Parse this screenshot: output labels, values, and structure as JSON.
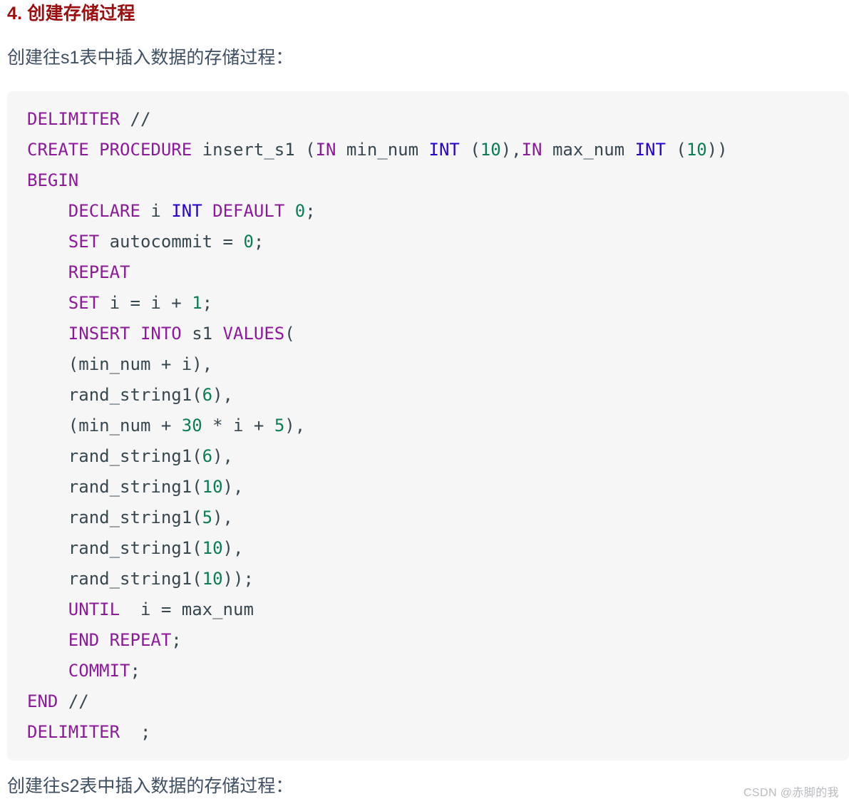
{
  "heading": "4. 创建存储过程",
  "intro_paragraph": "创建往s1表中插入数据的存储过程：",
  "closing_paragraph": "创建往s2表中插入数据的存储过程：",
  "watermark": "CSDN @赤脚的我",
  "colors": {
    "heading": "#9c0f10",
    "body_text": "#3f5063",
    "code_background": "#f6f6f7",
    "keyword": "#8d1a9b",
    "type": "#2a00d0",
    "number": "#0a7d55",
    "identifier": "#37474f",
    "watermark": "#b9bcc0"
  },
  "code": {
    "language": "sql",
    "lines": [
      [
        {
          "t": "DELIMITER",
          "c": "kw"
        },
        {
          "t": " ",
          "c": "id"
        },
        {
          "t": "//",
          "c": "id"
        }
      ],
      [
        {
          "t": "CREATE PROCEDURE",
          "c": "kw"
        },
        {
          "t": " insert_s1 (",
          "c": "id"
        },
        {
          "t": "IN",
          "c": "kw"
        },
        {
          "t": " min_num ",
          "c": "id"
        },
        {
          "t": "INT",
          "c": "typ"
        },
        {
          "t": " (",
          "c": "id"
        },
        {
          "t": "10",
          "c": "num"
        },
        {
          "t": "),",
          "c": "id"
        },
        {
          "t": "IN",
          "c": "kw"
        },
        {
          "t": " max_num ",
          "c": "id"
        },
        {
          "t": "INT",
          "c": "typ"
        },
        {
          "t": " (",
          "c": "id"
        },
        {
          "t": "10",
          "c": "num"
        },
        {
          "t": "))",
          "c": "id"
        }
      ],
      [
        {
          "t": "BEGIN",
          "c": "kw"
        }
      ],
      [
        {
          "t": "    ",
          "c": "id"
        },
        {
          "t": "DECLARE",
          "c": "kw"
        },
        {
          "t": " i ",
          "c": "id"
        },
        {
          "t": "INT",
          "c": "typ"
        },
        {
          "t": " ",
          "c": "id"
        },
        {
          "t": "DEFAULT",
          "c": "kw"
        },
        {
          "t": " ",
          "c": "id"
        },
        {
          "t": "0",
          "c": "num"
        },
        {
          "t": ";",
          "c": "id"
        }
      ],
      [
        {
          "t": "    ",
          "c": "id"
        },
        {
          "t": "SET",
          "c": "kw"
        },
        {
          "t": " autocommit = ",
          "c": "id"
        },
        {
          "t": "0",
          "c": "num"
        },
        {
          "t": ";",
          "c": "id"
        }
      ],
      [
        {
          "t": "    ",
          "c": "id"
        },
        {
          "t": "REPEAT",
          "c": "kw"
        }
      ],
      [
        {
          "t": "    ",
          "c": "id"
        },
        {
          "t": "SET",
          "c": "kw"
        },
        {
          "t": " i = i + ",
          "c": "id"
        },
        {
          "t": "1",
          "c": "num"
        },
        {
          "t": ";",
          "c": "id"
        }
      ],
      [
        {
          "t": "    ",
          "c": "id"
        },
        {
          "t": "INSERT INTO",
          "c": "kw"
        },
        {
          "t": " s1 ",
          "c": "id"
        },
        {
          "t": "VALUES",
          "c": "kw"
        },
        {
          "t": "(",
          "c": "id"
        }
      ],
      [
        {
          "t": "    (min_num + i),",
          "c": "id"
        }
      ],
      [
        {
          "t": "    rand_string1(",
          "c": "id"
        },
        {
          "t": "6",
          "c": "num"
        },
        {
          "t": "),",
          "c": "id"
        }
      ],
      [
        {
          "t": "    (min_num + ",
          "c": "id"
        },
        {
          "t": "30",
          "c": "num"
        },
        {
          "t": " * i + ",
          "c": "id"
        },
        {
          "t": "5",
          "c": "num"
        },
        {
          "t": "),",
          "c": "id"
        }
      ],
      [
        {
          "t": "    rand_string1(",
          "c": "id"
        },
        {
          "t": "6",
          "c": "num"
        },
        {
          "t": "),",
          "c": "id"
        }
      ],
      [
        {
          "t": "    rand_string1(",
          "c": "id"
        },
        {
          "t": "10",
          "c": "num"
        },
        {
          "t": "),",
          "c": "id"
        }
      ],
      [
        {
          "t": "    rand_string1(",
          "c": "id"
        },
        {
          "t": "5",
          "c": "num"
        },
        {
          "t": "),",
          "c": "id"
        }
      ],
      [
        {
          "t": "    rand_string1(",
          "c": "id"
        },
        {
          "t": "10",
          "c": "num"
        },
        {
          "t": "),",
          "c": "id"
        }
      ],
      [
        {
          "t": "    rand_string1(",
          "c": "id"
        },
        {
          "t": "10",
          "c": "num"
        },
        {
          "t": "));",
          "c": "id"
        }
      ],
      [
        {
          "t": "    ",
          "c": "id"
        },
        {
          "t": "UNTIL",
          "c": "kw"
        },
        {
          "t": "  i = max_num",
          "c": "id"
        }
      ],
      [
        {
          "t": "    ",
          "c": "id"
        },
        {
          "t": "END REPEAT",
          "c": "kw"
        },
        {
          "t": ";",
          "c": "id"
        }
      ],
      [
        {
          "t": "    ",
          "c": "id"
        },
        {
          "t": "COMMIT",
          "c": "kw"
        },
        {
          "t": ";",
          "c": "id"
        }
      ],
      [
        {
          "t": "END",
          "c": "kw"
        },
        {
          "t": " ",
          "c": "id"
        },
        {
          "t": "//",
          "c": "id"
        }
      ],
      [
        {
          "t": "DELIMITER",
          "c": "kw"
        },
        {
          "t": "  ;",
          "c": "id"
        }
      ]
    ]
  }
}
